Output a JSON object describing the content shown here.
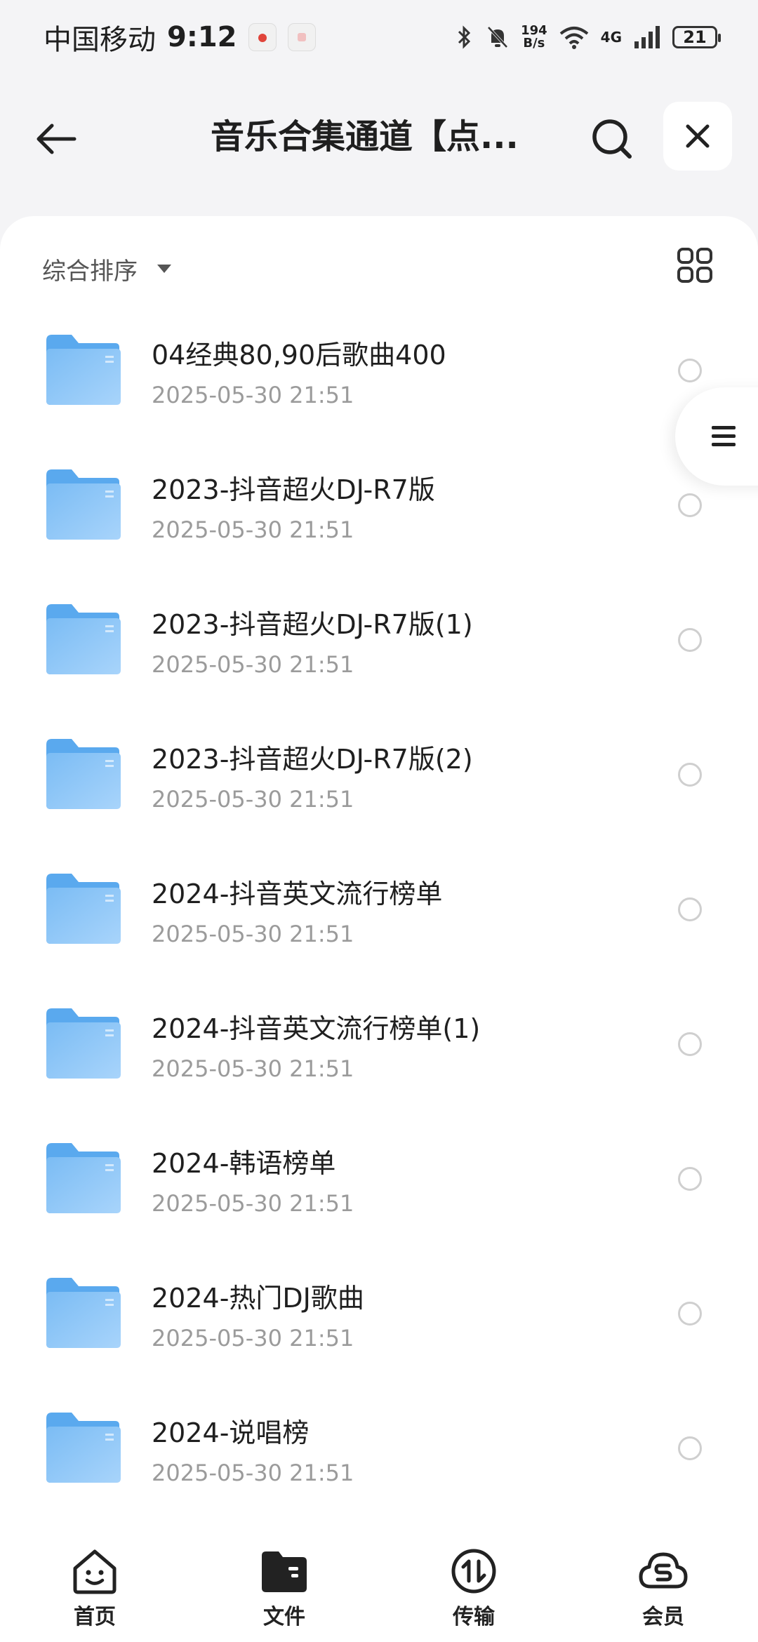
{
  "status_bar": {
    "carrier": "中国移动",
    "time": "9:12",
    "net_speed_value": "194",
    "net_speed_unit": "B/s",
    "network": "4G",
    "battery": "21",
    "icons": [
      "bluetooth-icon",
      "mute-bell-icon",
      "wifi-icon",
      "signal-icon",
      "battery-icon"
    ]
  },
  "header": {
    "title": "音乐合集通道【点..."
  },
  "toolbar": {
    "sort_label": "综合排序"
  },
  "files": [
    {
      "name": "04经典80,90后歌曲400",
      "date": "2025-05-30 21:51"
    },
    {
      "name": "2023-抖音超火DJ-R7版",
      "date": "2025-05-30 21:51"
    },
    {
      "name": "2023-抖音超火DJ-R7版(1)",
      "date": "2025-05-30 21:51"
    },
    {
      "name": "2023-抖音超火DJ-R7版(2)",
      "date": "2025-05-30 21:51"
    },
    {
      "name": "2024-抖音英文流行榜单",
      "date": "2025-05-30 21:51"
    },
    {
      "name": "2024-抖音英文流行榜单(1)",
      "date": "2025-05-30 21:51"
    },
    {
      "name": "2024-韩语榜单",
      "date": "2025-05-30 21:51"
    },
    {
      "name": "2024-热门DJ歌曲",
      "date": "2025-05-30 21:51"
    },
    {
      "name": "2024-说唱榜",
      "date": "2025-05-30 21:51"
    }
  ],
  "bottom_nav": {
    "items": [
      {
        "label": "首页",
        "icon": "home-face-icon"
      },
      {
        "label": "文件",
        "icon": "folder-icon"
      },
      {
        "label": "传输",
        "icon": "transfer-icon"
      },
      {
        "label": "会员",
        "icon": "vip-cloud-icon"
      }
    ]
  },
  "colors": {
    "background": "#f4f4f6",
    "card": "#ffffff",
    "folder_blue": "#6fb6f5",
    "date_gray": "#9b9b9b"
  }
}
